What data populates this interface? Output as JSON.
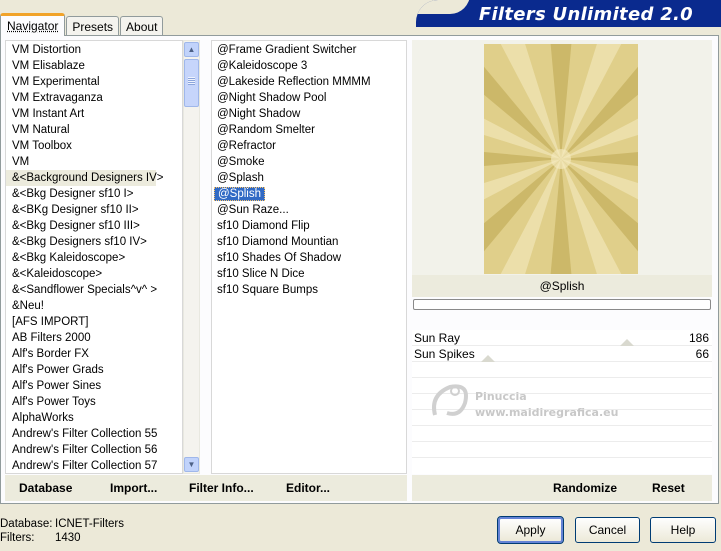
{
  "window": {
    "banner_title": "Filters Unlimited 2.0"
  },
  "tabs": [
    {
      "label": "Navigator",
      "active": true
    },
    {
      "label": "Presets",
      "active": false
    },
    {
      "label": "About",
      "active": false
    }
  ],
  "categories": [
    "VM Distortion",
    "VM Elisablaze",
    "VM Experimental",
    "VM Extravaganza",
    "VM Instant Art",
    "VM Natural",
    "VM Toolbox",
    "VM",
    "&<Background Designers IV>",
    "&<Bkg Designer sf10 I>",
    "&<BKg Designer sf10 II>",
    "&<Bkg Designer sf10 III>",
    "&<Bkg Designers sf10 IV>",
    "&<Bkg Kaleidoscope>",
    "&<Kaleidoscope>",
    "&<Sandflower Specials^v^ >",
    "&Neu!",
    "[AFS IMPORT]",
    "AB Filters 2000",
    "Alf's Border FX",
    "Alf's Power Grads",
    "Alf's Power Sines",
    "Alf's Power Toys",
    "AlphaWorks",
    "Andrew's Filter Collection 55",
    "Andrew's Filter Collection 56",
    "Andrew's Filter Collection 57"
  ],
  "selected_category": "&<Background Designers IV>",
  "filters": [
    "@Frame Gradient Switcher",
    "@Kaleidoscope 3",
    "@Lakeside Reflection MMMM",
    "@Night Shadow Pool",
    "@Night Shadow",
    "@Random Smelter",
    "@Refractor",
    "@Smoke",
    "@Splash",
    "@Splish",
    "@Sun Raze...",
    "sf10 Diamond Flip",
    "sf10 Diamond Mountian",
    "sf10 Shades Of Shadow",
    "sf10 Slice N Dice",
    "sf10 Square Bumps"
  ],
  "selected_filter": "@Splish",
  "preview": {
    "filter_name": "@Splish",
    "progress": 0,
    "image_colors": {
      "base": "#e0cf8a",
      "light": "#f6edc4",
      "dark": "#bca64e"
    }
  },
  "params": [
    {
      "name": "Sun Ray",
      "value": "186",
      "level": 0.73
    },
    {
      "name": "Sun Spikes",
      "value": "66",
      "level": 0.26
    }
  ],
  "watermark": {
    "line1": "Pinuccia",
    "line2": "www.maidiregrafica.eu"
  },
  "left_bar": {
    "database": "Database",
    "import": "Import...",
    "filter_info": "Filter Info...",
    "editor": "Editor..."
  },
  "right_bar": {
    "randomize": "Randomize",
    "reset": "Reset"
  },
  "footer": {
    "database_label": "Database:",
    "database_value": "ICNET-Filters",
    "filters_label": "Filters:",
    "filters_value": "1430"
  },
  "buttons": {
    "apply": "Apply",
    "cancel": "Cancel",
    "help": "Help"
  },
  "icons": {
    "scroll_up": "up-arrow-icon",
    "scroll_down": "down-arrow-icon"
  }
}
